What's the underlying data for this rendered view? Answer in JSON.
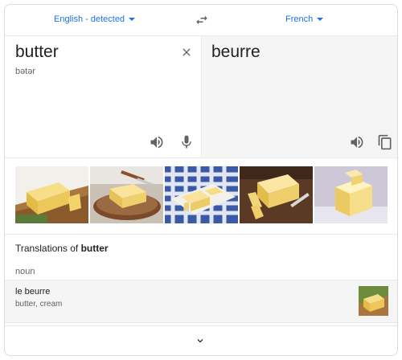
{
  "languages": {
    "source": "English - detected",
    "target": "French"
  },
  "source": {
    "text": "butter",
    "transliteration": "bətər"
  },
  "target": {
    "text": "beurre"
  },
  "images": [
    "butter-image-1",
    "butter-image-2",
    "butter-image-3",
    "butter-image-4",
    "butter-image-5"
  ],
  "dictionary": {
    "title_prefix": "Translations of ",
    "title_word": "butter",
    "part_of_speech": "noun",
    "entries": [
      {
        "term": "le beurre",
        "synonyms": "butter, cream"
      }
    ]
  },
  "colors": {
    "accent": "#1a73e8",
    "icon": "#5f6368"
  }
}
